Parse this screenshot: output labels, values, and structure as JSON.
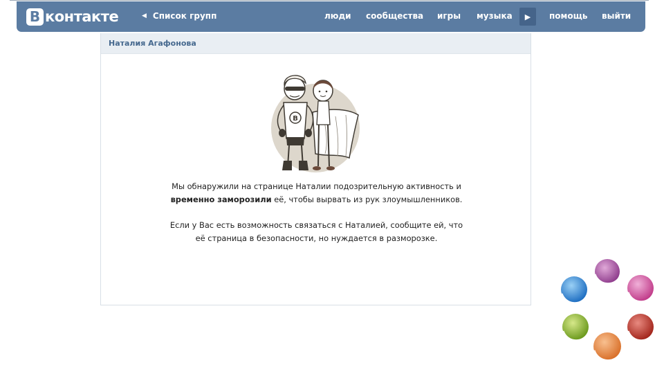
{
  "header": {
    "logo_letter": "В",
    "logo_text": "контакте",
    "back_label": "Список групп",
    "nav": [
      "люди",
      "сообщества",
      "игры",
      "музыка",
      "помощь",
      "выйти"
    ]
  },
  "profile": {
    "name": "Наталия Агафонова"
  },
  "message": {
    "line1": "Мы обнаружили на странице Наталии подозрительную активность и",
    "line2_bold": "временно заморозили",
    "line2_rest": " её, чтобы вырвать из рук злоумышленников.",
    "line3": "Если у Вас есть возможность связаться с Наталией, сообщите ей, что",
    "line4": "её страница в безопасности, но нуждается в разморозке."
  },
  "colors": {
    "header_bg": "#5b7ca2",
    "card_head_bg": "#e9eef3",
    "name_color": "#45688e"
  },
  "icons": {
    "back": "triangle-left-icon",
    "player": "play-icon",
    "illustration": "superhero-couple-illustration",
    "decoration": "colored-spheres-ring"
  }
}
